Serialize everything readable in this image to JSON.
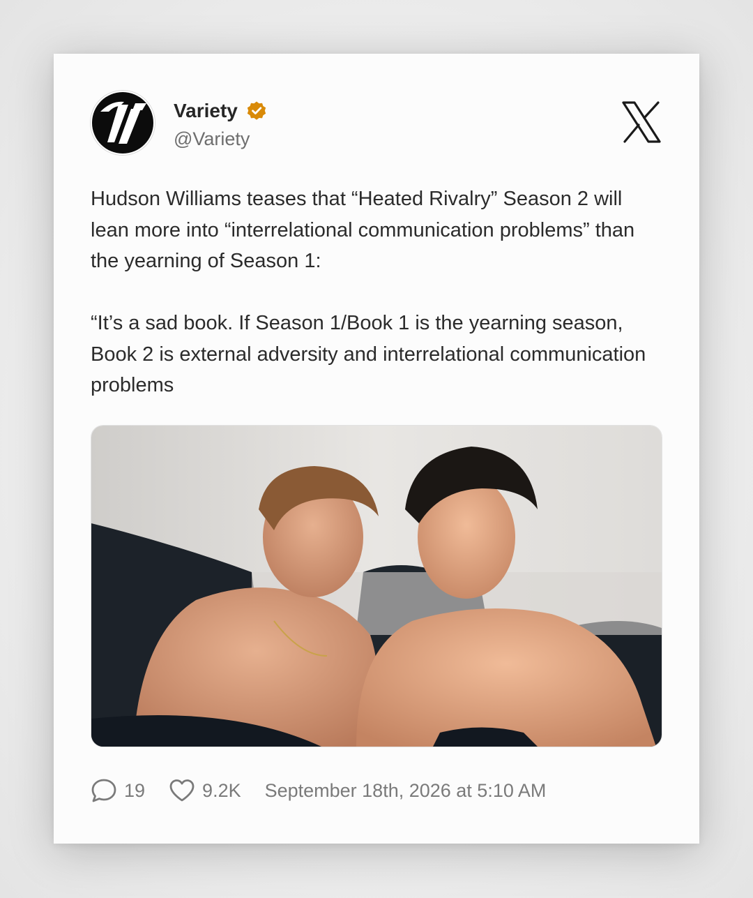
{
  "post": {
    "author": {
      "display_name": "Variety",
      "handle": "@Variety",
      "verified": true,
      "avatar_icon": "variety-v-logo",
      "verified_badge_color": "#D98A08"
    },
    "platform_icon": "x-logo-icon",
    "text": "Hudson Williams teases that “Heated Rivalry” Season 2 will lean more into “interrelational communication problems” than the yearning of Season 1:\n\n“It’s a sad book. If Season 1/Book 1 is the yearning season, Book 2 is external adversity and interrelational communication problems",
    "media": {
      "kind": "photo"
    },
    "metrics": {
      "replies": "19",
      "replies_icon": "comment-icon",
      "likes": "9.2K",
      "likes_icon": "heart-icon"
    },
    "timestamp": "September 18th, 2026 at 5:10 AM"
  },
  "colors": {
    "text_primary": "#2B2B2B",
    "text_secondary": "#6E6E6E",
    "card_background": "#FCFCFC"
  }
}
